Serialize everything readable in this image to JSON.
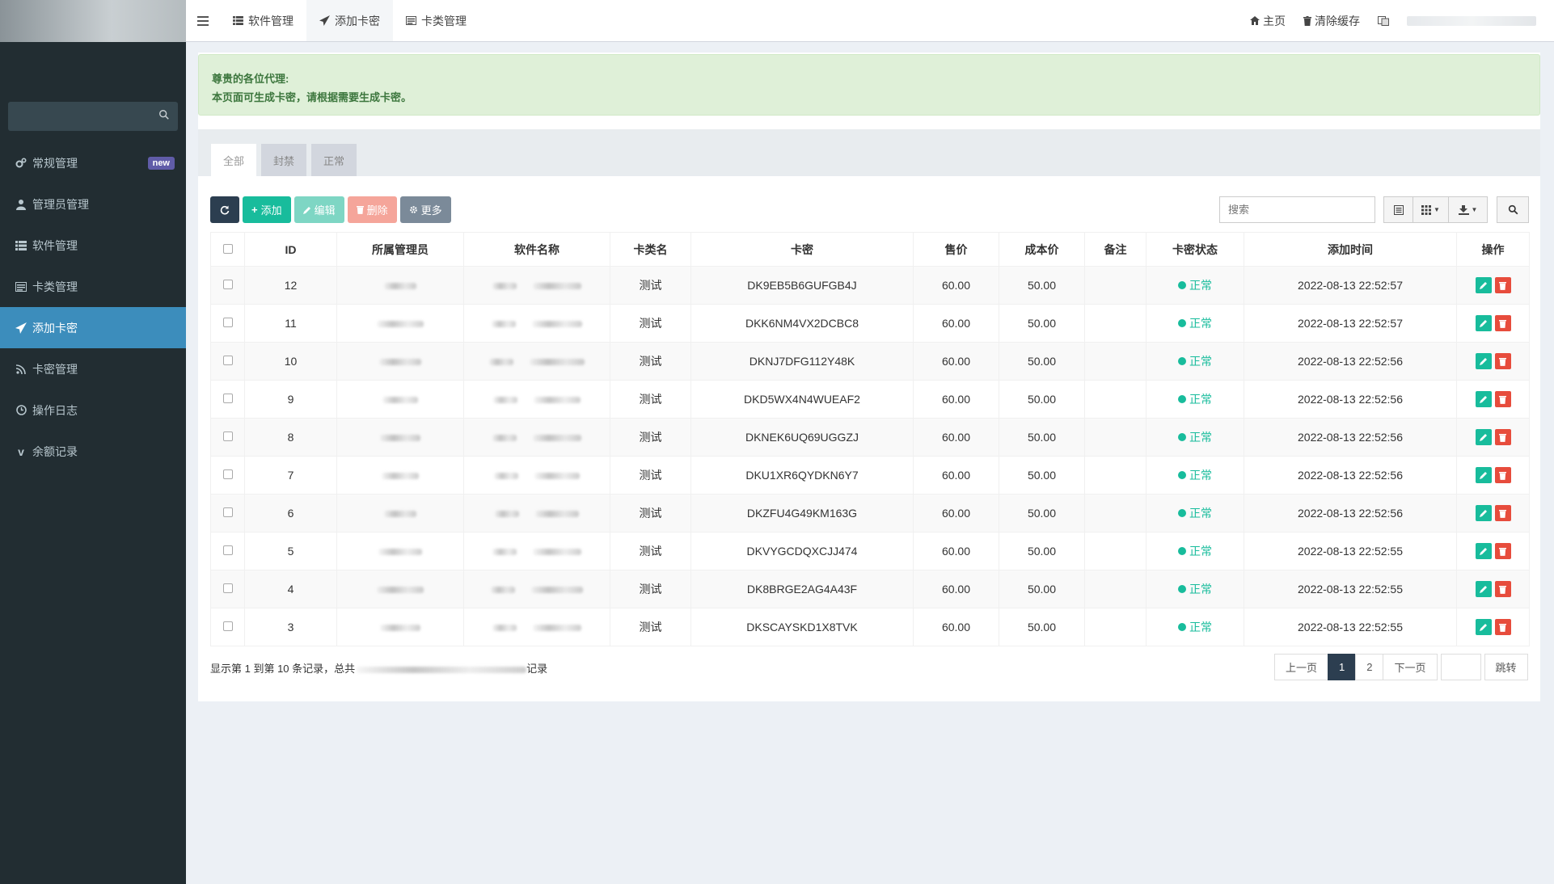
{
  "sidebar": {
    "search_placeholder": "",
    "menu": [
      {
        "label": "常规管理",
        "icon": "cogs-icon",
        "badge": "new"
      },
      {
        "label": "管理员管理",
        "icon": "user-icon"
      },
      {
        "label": "软件管理",
        "icon": "list-icon"
      },
      {
        "label": "卡类管理",
        "icon": "list-alt-icon"
      },
      {
        "label": "添加卡密",
        "icon": "paper-plane-icon",
        "active": true
      },
      {
        "label": "卡密管理",
        "icon": "rss-icon"
      },
      {
        "label": "操作日志",
        "icon": "clock-icon"
      },
      {
        "label": "余额记录",
        "icon": "vimeo-icon"
      }
    ]
  },
  "topbar": {
    "tabs": [
      {
        "label": "软件管理"
      },
      {
        "label": "添加卡密",
        "active": true
      },
      {
        "label": "卡类管理"
      }
    ],
    "home_label": "主页",
    "clear_cache_label": "清除缓存"
  },
  "notice": {
    "line1": "尊贵的各位代理:",
    "line2": "本页面可生成卡密，请根据需要生成卡密。"
  },
  "filter_tabs": [
    "全部",
    "封禁",
    "正常"
  ],
  "toolbar": {
    "add_label": "添加",
    "edit_label": "编辑",
    "delete_label": "删除",
    "more_label": "更多",
    "search_placeholder": "搜索"
  },
  "table": {
    "columns": [
      "ID",
      "所属管理员",
      "软件名称",
      "卡类名",
      "卡密",
      "售价",
      "成本价",
      "备注",
      "卡密状态",
      "添加时间",
      "操作"
    ],
    "rows": [
      {
        "id": "12",
        "type": "测试",
        "card": "DK9EB5B6GUFGB4J",
        "price": "60.00",
        "cost": "50.00",
        "remark": "",
        "status": "正常",
        "time": "2022-08-13 22:52:57"
      },
      {
        "id": "11",
        "type": "测试",
        "card": "DKK6NM4VX2DCBC8",
        "price": "60.00",
        "cost": "50.00",
        "remark": "",
        "status": "正常",
        "time": "2022-08-13 22:52:57"
      },
      {
        "id": "10",
        "type": "测试",
        "card": "DKNJ7DFG112Y48K",
        "price": "60.00",
        "cost": "50.00",
        "remark": "",
        "status": "正常",
        "time": "2022-08-13 22:52:56"
      },
      {
        "id": "9",
        "type": "测试",
        "card": "DKD5WX4N4WUEAF2",
        "price": "60.00",
        "cost": "50.00",
        "remark": "",
        "status": "正常",
        "time": "2022-08-13 22:52:56"
      },
      {
        "id": "8",
        "type": "测试",
        "card": "DKNEK6UQ69UGGZJ",
        "price": "60.00",
        "cost": "50.00",
        "remark": "",
        "status": "正常",
        "time": "2022-08-13 22:52:56"
      },
      {
        "id": "7",
        "type": "测试",
        "card": "DKU1XR6QYDKN6Y7",
        "price": "60.00",
        "cost": "50.00",
        "remark": "",
        "status": "正常",
        "time": "2022-08-13 22:52:56"
      },
      {
        "id": "6",
        "type": "测试",
        "card": "DKZFU4G49KM163G",
        "price": "60.00",
        "cost": "50.00",
        "remark": "",
        "status": "正常",
        "time": "2022-08-13 22:52:56"
      },
      {
        "id": "5",
        "type": "测试",
        "card": "DKVYGCDQXCJJ474",
        "price": "60.00",
        "cost": "50.00",
        "remark": "",
        "status": "正常",
        "time": "2022-08-13 22:52:55"
      },
      {
        "id": "4",
        "type": "测试",
        "card": "DK8BRGE2AG4A43F",
        "price": "60.00",
        "cost": "50.00",
        "remark": "",
        "status": "正常",
        "time": "2022-08-13 22:52:55"
      },
      {
        "id": "3",
        "type": "测试",
        "card": "DKSCAYSKD1X8TVK",
        "price": "60.00",
        "cost": "50.00",
        "remark": "",
        "status": "正常",
        "time": "2022-08-13 22:52:55"
      }
    ]
  },
  "footer": {
    "summary": "显示第 1 到第 10 条记录，总共",
    "summary_tail": "记录"
  },
  "pagination": {
    "prev": "上一页",
    "pages": [
      "1",
      "2"
    ],
    "next": "下一页",
    "go": "跳转"
  },
  "colors": {
    "sidebar_bg": "#222d32",
    "active_menu": "#3c8dbc",
    "success": "#18bc9c",
    "danger": "#e74c3c",
    "dark": "#2c3e50"
  }
}
